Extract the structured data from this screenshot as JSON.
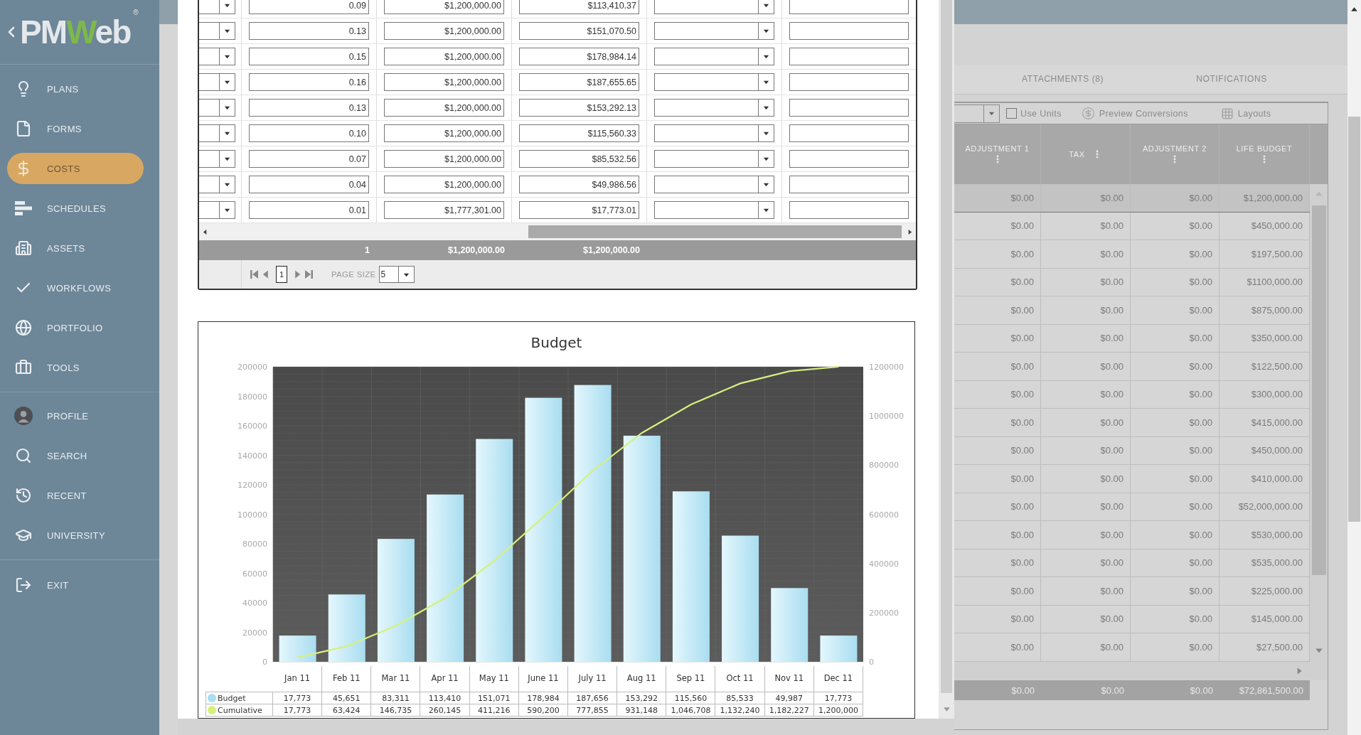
{
  "sidebar": {
    "logo": {
      "parts": [
        {
          "text": "PM",
          "color": "#e4e8eb"
        },
        {
          "text": "W",
          "color": "#7db84c"
        },
        {
          "text": "eb",
          "color": "#e4e8eb"
        }
      ],
      "mark": "®"
    },
    "sections": [
      {
        "items": [
          {
            "label": "PLANS",
            "selected": false
          },
          {
            "label": "FORMS",
            "selected": false
          },
          {
            "label": "COSTS",
            "selected": true
          },
          {
            "label": "SCHEDULES",
            "selected": false
          },
          {
            "label": "ASSETS",
            "selected": false
          },
          {
            "label": "WORKFLOWS",
            "selected": false
          },
          {
            "label": "PORTFOLIO",
            "selected": false
          },
          {
            "label": "TOOLS",
            "selected": false
          }
        ]
      },
      {
        "items": [
          {
            "label": "PROFILE",
            "selected": false
          },
          {
            "label": "SEARCH",
            "selected": false
          },
          {
            "label": "RECENT",
            "selected": false
          },
          {
            "label": "UNIVERSITY",
            "selected": false
          }
        ]
      },
      {
        "items": [
          {
            "label": "EXIT",
            "selected": false
          }
        ]
      }
    ]
  },
  "modal": {
    "grid": {
      "rows": [
        {
          "column_2": "0.09",
          "column_3": "$1,200,000.00",
          "column_4": "$113,410.37"
        },
        {
          "column_2": "0.13",
          "column_3": "$1,200,000.00",
          "column_4": "$151,070.50"
        },
        {
          "column_2": "0.15",
          "column_3": "$1,200,000.00",
          "column_4": "$178,984.14"
        },
        {
          "column_2": "0.16",
          "column_3": "$1,200,000.00",
          "column_4": "$187,655.65"
        },
        {
          "column_2": "0.13",
          "column_3": "$1,200,000.00",
          "column_4": "$153,292.13"
        },
        {
          "column_2": "0.10",
          "column_3": "$1,200,000.00",
          "column_4": "$115,560.33"
        },
        {
          "column_2": "0.07",
          "column_3": "$1,200,000.00",
          "column_4": "$85,532.56"
        },
        {
          "column_2": "0.04",
          "column_3": "$1,200,000.00",
          "column_4": "$49,986.56"
        },
        {
          "column_2": "0.01",
          "column_3": "$1,777,301.00",
          "column_4": "$17,773.01"
        }
      ],
      "totals": [
        "1",
        "$1,200,000.00",
        "$1,200,000.00"
      ],
      "pager": {
        "page": "1",
        "page_size_label": "PAGE SIZE",
        "page_size": "5"
      }
    },
    "chart": {
      "bars": {
        "chart_data": {
          "type": "bar",
          "title": "Budget",
          "categories": [
            "Jan 11",
            "Feb 11",
            "Mar 11",
            "Apr 11",
            "May 11",
            "June 11",
            "July 11",
            "Aug 11",
            "Sep 11",
            "Oct 11",
            "Nov 11",
            "Dec 11"
          ],
          "series": [
            {
              "name": "Budget",
              "color": "#a9ddf0",
              "values": [
                17773,
                45651,
                83311,
                113410,
                151071,
                178984,
                187656,
                153292,
                115560,
                85533,
                49987,
                17773
              ]
            }
          ],
          "ylim": [
            0,
            200000
          ],
          "yticks": [
            0,
            20000,
            40000,
            60000,
            80000,
            100000,
            120000,
            140000,
            160000,
            180000,
            200000
          ],
          "grid": true
        }
      },
      "line": {
        "chart_data": {
          "type": "line",
          "series": [
            {
              "name": "Cumulative",
              "color": "#d6f07c",
              "values": [
                17773,
                63424,
                146735,
                260145,
                411216,
                590200,
                777855,
                931148,
                1046708,
                1132240,
                1182227,
                1200000
              ]
            }
          ],
          "ylim": [
            0,
            1200000
          ],
          "yticks": [
            0,
            200000,
            400000,
            600000,
            800000,
            1000000,
            1200000
          ]
        }
      },
      "data_table": {
        "rows": [
          {
            "cells": [
              "17,773",
              "45,651",
              "83,311",
              "113,410",
              "151,071",
              "178,984",
              "187,656",
              "153,292",
              "115,560",
              "85,533",
              "49,987",
              "17,773"
            ]
          },
          {
            "cells": [
              "17,773",
              "63,424",
              "146,735",
              "260,145",
              "411,216",
              "590,200",
              "777,855",
              "931,148",
              "1,046,708",
              "1,132,240",
              "1,182,227",
              "1,200,000"
            ]
          }
        ]
      }
    }
  },
  "panel": {
    "tabs": [
      {
        "label": "ATTACHMENTS (8)",
        "selected": false
      },
      {
        "label": "NOTIFICATIONS",
        "selected": false
      }
    ],
    "toolbar": {
      "use_units": {
        "label": "Use Units",
        "checked": false
      },
      "preview": "Preview Conversions",
      "layouts": "Layouts"
    },
    "table": {
      "columns": [
        "ADJUSTMENT 1",
        "TAX",
        "ADJUSTMENT 2",
        "LIFE BUDGET"
      ],
      "rows": [
        {
          "selected": true,
          "cells": [
            "$0.00",
            "$0.00",
            "$0.00",
            "$1,200,000.00"
          ]
        },
        {
          "selected": false,
          "cells": [
            "$0.00",
            "$0.00",
            "$0.00",
            "$450,000.00"
          ]
        },
        {
          "selected": false,
          "cells": [
            "$0.00",
            "$0.00",
            "$0.00",
            "$197,500.00"
          ]
        },
        {
          "selected": false,
          "cells": [
            "$0.00",
            "$0.00",
            "$0.00",
            "$1100,000.00"
          ]
        },
        {
          "selected": false,
          "cells": [
            "$0.00",
            "$0.00",
            "$0.00",
            "$875,000.00"
          ]
        },
        {
          "selected": false,
          "cells": [
            "$0.00",
            "$0.00",
            "$0.00",
            "$350,000.00"
          ]
        },
        {
          "selected": false,
          "cells": [
            "$0.00",
            "$0.00",
            "$0.00",
            "$122,500.00"
          ]
        },
        {
          "selected": false,
          "cells": [
            "$0.00",
            "$0.00",
            "$0.00",
            "$300,000.00"
          ]
        },
        {
          "selected": false,
          "cells": [
            "$0.00",
            "$0.00",
            "$0.00",
            "$415,000.00"
          ]
        },
        {
          "selected": false,
          "cells": [
            "$0.00",
            "$0.00",
            "$0.00",
            "$450,000.00"
          ]
        },
        {
          "selected": false,
          "cells": [
            "$0.00",
            "$0.00",
            "$0.00",
            "$410,000.00"
          ]
        },
        {
          "selected": false,
          "cells": [
            "$0.00",
            "$0.00",
            "$0.00",
            "$52,000,000.00"
          ]
        },
        {
          "selected": false,
          "cells": [
            "$0.00",
            "$0.00",
            "$0.00",
            "$530,000.00"
          ]
        },
        {
          "selected": false,
          "cells": [
            "$0.00",
            "$0.00",
            "$0.00",
            "$535,000.00"
          ]
        },
        {
          "selected": false,
          "cells": [
            "$0.00",
            "$0.00",
            "$0.00",
            "$225,000.00"
          ]
        },
        {
          "selected": false,
          "cells": [
            "$0.00",
            "$0.00",
            "$0.00",
            "$145,000.00"
          ]
        },
        {
          "selected": false,
          "cells": [
            "$0.00",
            "$0.00",
            "$0.00",
            "$27,500.00"
          ]
        }
      ],
      "totals": [
        "$0.00",
        "$0.00",
        "$0.00",
        "$72,861,500.00"
      ]
    }
  }
}
